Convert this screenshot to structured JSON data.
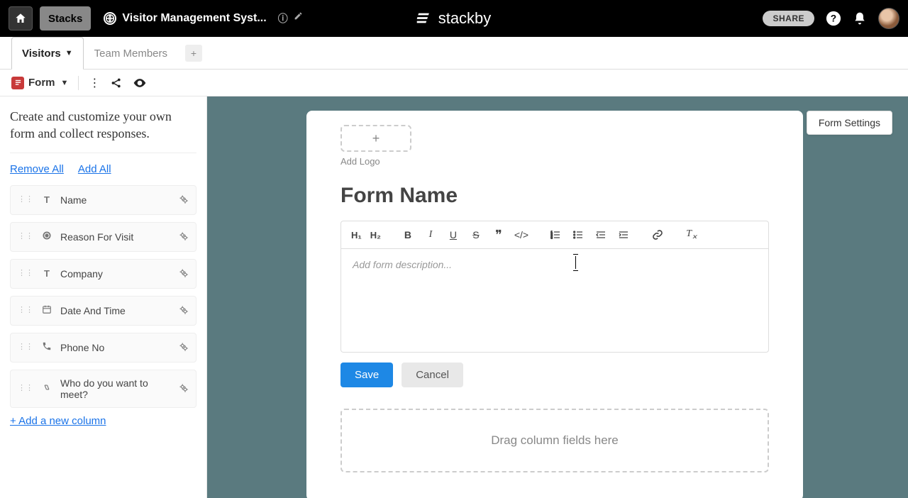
{
  "topbar": {
    "stacks_label": "Stacks",
    "workspace_name": "Visitor Management Syst...",
    "brand_name": "stackby",
    "share_label": "SHARE"
  },
  "tabs": {
    "items": [
      {
        "label": "Visitors",
        "active": true
      },
      {
        "label": "Team Members",
        "active": false
      }
    ]
  },
  "toolbar": {
    "view_label": "Form"
  },
  "sidebar": {
    "description": "Create and customize your own form and collect responses.",
    "remove_all": "Remove All",
    "add_all": "Add All",
    "fields": [
      {
        "type": "text",
        "label": "Name"
      },
      {
        "type": "select",
        "label": "Reason For Visit"
      },
      {
        "type": "text",
        "label": "Company"
      },
      {
        "type": "date",
        "label": "Date And Time"
      },
      {
        "type": "phone",
        "label": "Phone No"
      },
      {
        "type": "link",
        "label": "Who do you want to meet?"
      }
    ],
    "add_column": "+ Add a new column"
  },
  "form": {
    "settings_label": "Form Settings",
    "add_logo": "Add Logo",
    "title": "Form Name",
    "description_placeholder": "Add form description...",
    "save": "Save",
    "cancel": "Cancel",
    "drop_hint": "Drag column fields here",
    "toolbar": {
      "h1": "H₁",
      "h2": "H₂"
    }
  }
}
